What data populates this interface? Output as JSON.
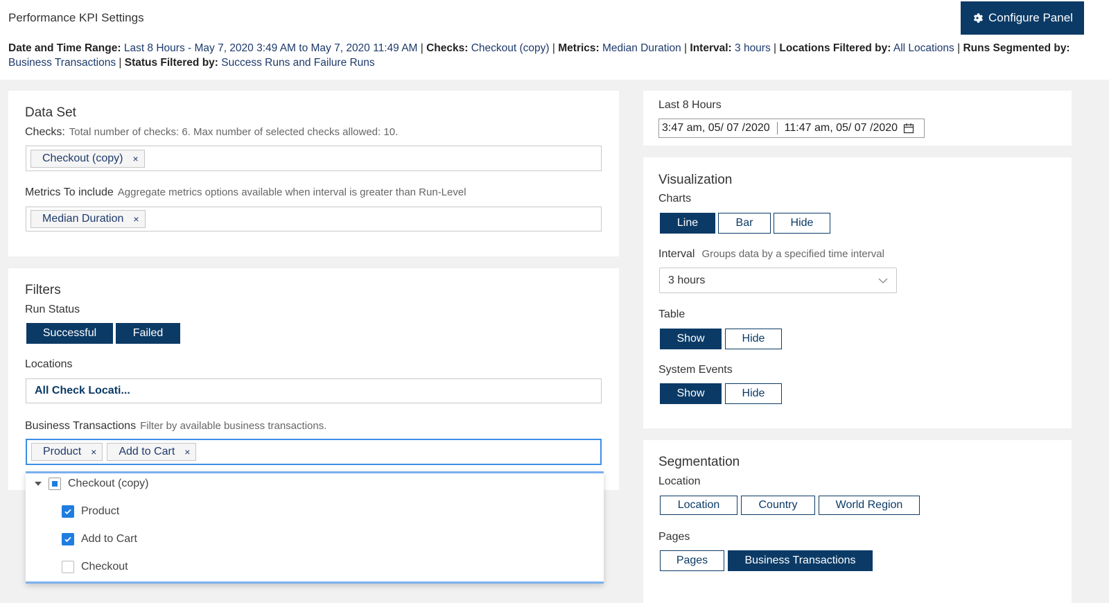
{
  "header": {
    "title": "Performance KPI Settings",
    "configure_button": "Configure Panel"
  },
  "summary": {
    "date_label": "Date and Time Range:",
    "date_value": "Last 8 Hours - May 7, 2020 3:49 AM to May 7, 2020 11:49 AM",
    "checks_label": "Checks:",
    "checks_value": "Checkout (copy)",
    "metrics_label": "Metrics:",
    "metrics_value": "Median Duration",
    "interval_label": "Interval:",
    "interval_value": "3 hours",
    "locations_label": "Locations Filtered by:",
    "locations_value": "All Locations",
    "segmented_label": "Runs Segmented by:",
    "segmented_value": "Business Transactions",
    "status_label": "Status Filtered by:",
    "status_value": "Success Runs and Failure Runs",
    "separator": "|"
  },
  "dataset": {
    "title": "Data Set",
    "checks_label": "Checks:",
    "checks_hint": "Total number of checks: 6. Max number of selected checks allowed: 10.",
    "checks_chips": [
      "Checkout (copy)"
    ],
    "metrics_label": "Metrics To include",
    "metrics_hint": "Aggregate metrics options available when interval is greater than Run-Level",
    "metrics_chips": [
      "Median Duration"
    ]
  },
  "filters": {
    "title": "Filters",
    "run_status_label": "Run Status",
    "run_status_buttons": [
      "Successful",
      "Failed"
    ],
    "locations_label": "Locations",
    "locations_value": "All Check Locati...",
    "bt_label": "Business Transactions",
    "bt_hint": "Filter by available business transactions.",
    "bt_chips": [
      "Product",
      "Add to Cart"
    ],
    "chip_remove": "×"
  },
  "bt_dropdown": {
    "group": "Checkout (copy)",
    "items": [
      {
        "label": "Product",
        "checked": true
      },
      {
        "label": "Add to Cart",
        "checked": true
      },
      {
        "label": "Checkout",
        "checked": false
      }
    ]
  },
  "time_range": {
    "label": "Last 8 Hours",
    "start": "3:47 am, 05/ 07 /2020",
    "end": "11:47 am, 05/ 07 /2020"
  },
  "visualization": {
    "title": "Visualization",
    "charts_label": "Charts",
    "charts_buttons": [
      "Line",
      "Bar",
      "Hide"
    ],
    "interval_label": "Interval",
    "interval_hint": "Groups data by a specified time interval",
    "interval_value": "3 hours",
    "table_label": "Table",
    "table_buttons": [
      "Show",
      "Hide"
    ],
    "events_label": "System Events",
    "events_buttons": [
      "Show",
      "Hide"
    ]
  },
  "segmentation": {
    "title": "Segmentation",
    "location_label": "Location",
    "location_buttons": [
      "Location",
      "Country",
      "World Region"
    ],
    "pages_label": "Pages",
    "pages_buttons": [
      "Pages",
      "Business Transactions"
    ]
  },
  "colors": {
    "primary": "#0b3a66",
    "focus": "#3d8ee6",
    "checkbox": "#1f7de1"
  }
}
